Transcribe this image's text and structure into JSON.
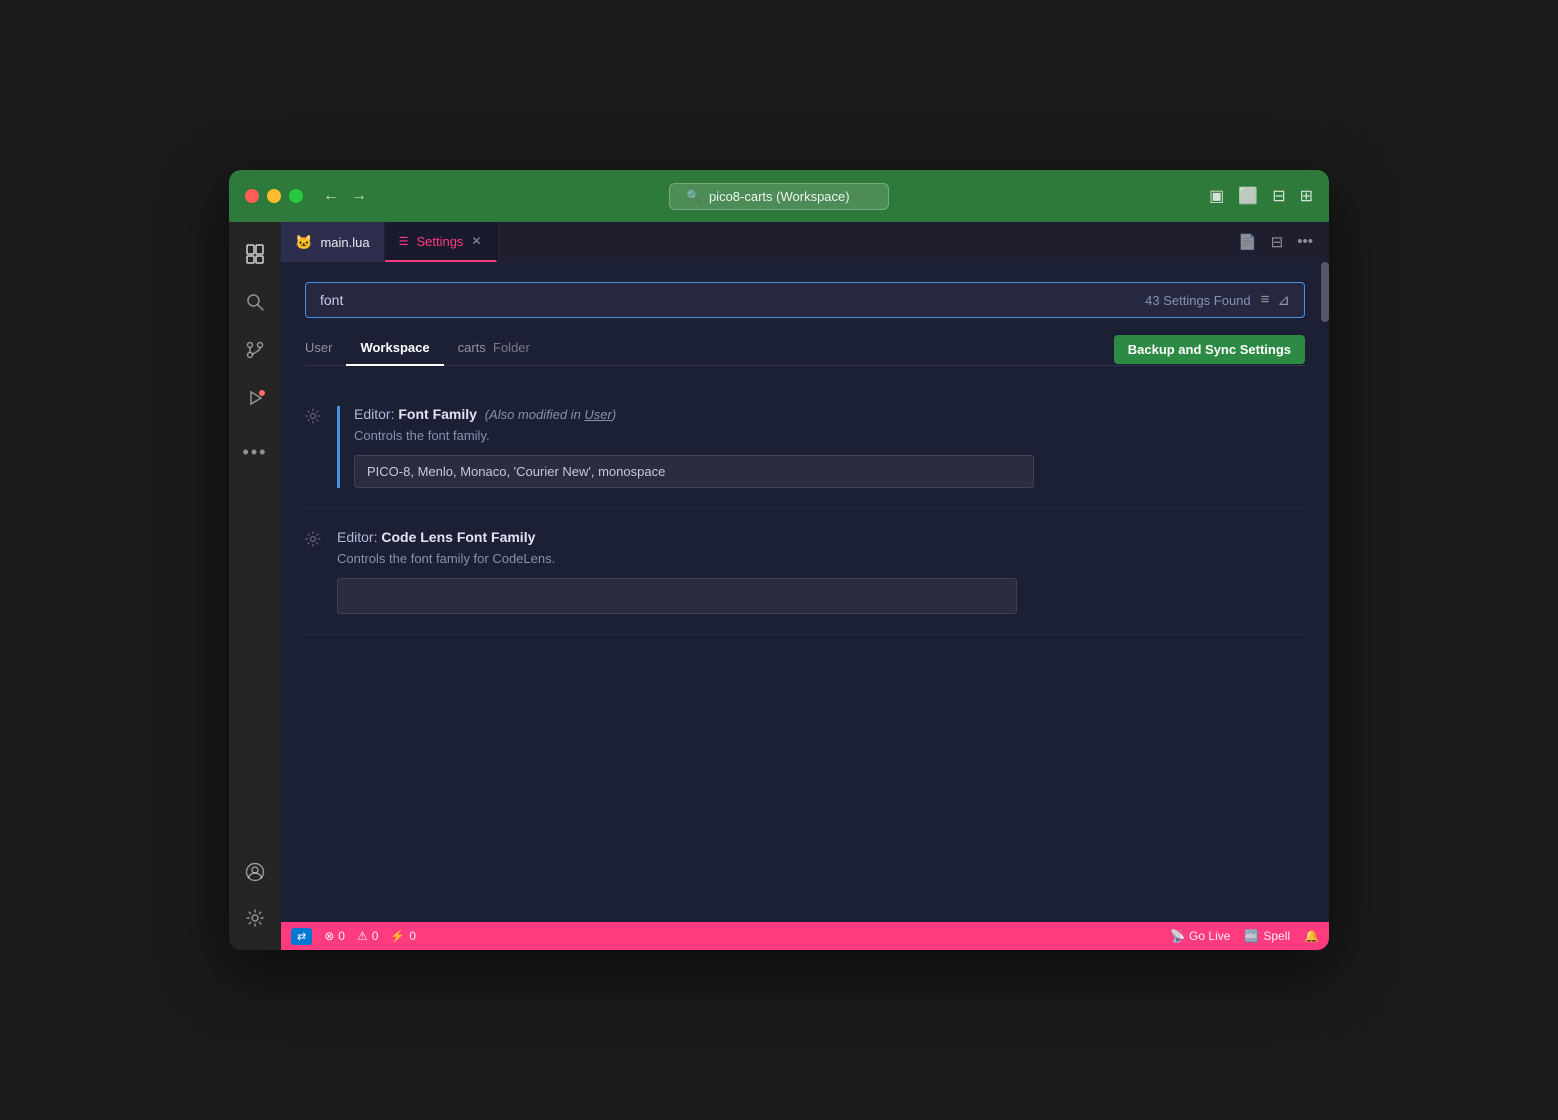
{
  "window": {
    "title": "pico8-carts (Workspace)"
  },
  "titlebar": {
    "search_text": "pico8-carts (Workspace)",
    "back_arrow": "←",
    "forward_arrow": "→"
  },
  "tabs": {
    "main_lua": "main.lua",
    "settings": "Settings"
  },
  "settings": {
    "search_value": "font",
    "found_count": "43 Settings Found",
    "tabs": [
      {
        "label": "User",
        "active": false
      },
      {
        "label": "Workspace",
        "active": true
      },
      {
        "label": "carts",
        "active": false
      },
      {
        "label": "Folder",
        "active": false
      }
    ],
    "backup_sync_button": "Backup and Sync Settings",
    "items": [
      {
        "title_prefix": "Editor: ",
        "title_main": "Font Family",
        "title_modifier": "(Also modified in User)",
        "description": "Controls the font family.",
        "input_value": "PICO-8, Menlo, Monaco, 'Courier New', monospace",
        "has_value": true
      },
      {
        "title_prefix": "Editor: ",
        "title_main": "Code Lens Font Family",
        "title_modifier": "",
        "description": "Controls the font family for CodeLens.",
        "input_value": "",
        "has_value": false
      }
    ]
  },
  "status_bar": {
    "sync_label": "⇄",
    "errors_count": "0",
    "warnings_count": "0",
    "info_count": "0",
    "go_live": "Go Live",
    "spell": "Spell",
    "notification_icon": "🔔"
  },
  "sidebar": {
    "icons": [
      {
        "name": "files-icon",
        "symbol": "⧉",
        "active": true
      },
      {
        "name": "search-icon",
        "symbol": "🔍",
        "active": false
      },
      {
        "name": "source-control-icon",
        "symbol": "⑂",
        "active": false
      },
      {
        "name": "run-debug-icon",
        "symbol": "▷",
        "active": false
      },
      {
        "name": "extensions-icon",
        "symbol": "⋯",
        "active": false
      }
    ],
    "bottom_icons": [
      {
        "name": "account-icon",
        "symbol": "👤"
      },
      {
        "name": "settings-gear-icon",
        "symbol": "⚙"
      }
    ]
  }
}
